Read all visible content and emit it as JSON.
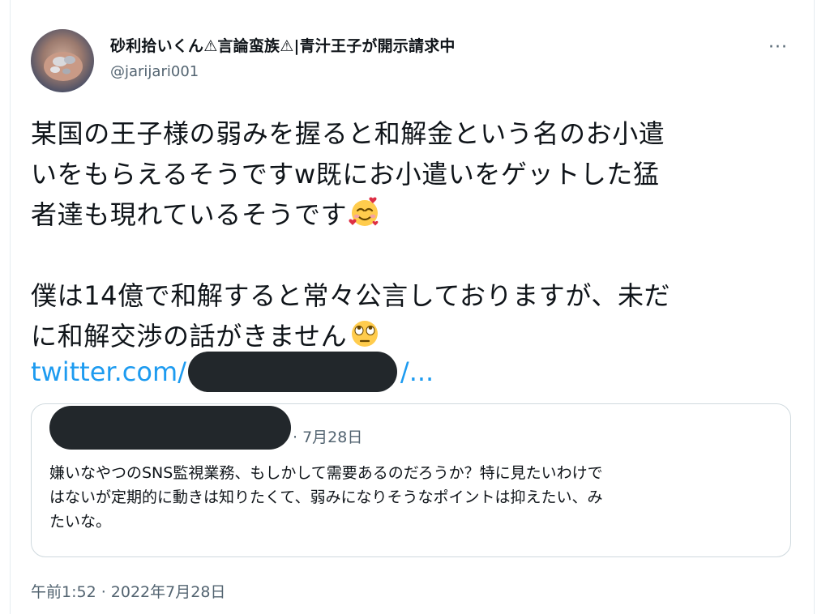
{
  "user": {
    "display_name": "砂利拾いくん⚠言論蛮族⚠|青汁王子が開示請求中",
    "handle": "@jarijari001",
    "more_label": "···"
  },
  "tweet": {
    "lines": [
      "某国の王子様の弱みを握ると和解金という名のお小遣",
      "いをもらえるそうですw既にお小遣いをゲットした猛",
      "者達も現れているそうです"
    ],
    "lines2": [
      "僕は14億で和解すると常々公言しておりますが、未だ",
      "に和解交渉の話がきません"
    ],
    "emoji1": "smiling-face-with-hearts",
    "emoji2": "face-with-rolling-eyes",
    "link_prefix": "twitter.com/",
    "link_suffix": "/..."
  },
  "quote": {
    "date": "· 7月28日",
    "lines": [
      "嫌いなやつのSNS監視業務、もしかして需要あるのだろうか？特に見たいわけで",
      "はないが定期的に動きは知りたくて、弱みになりそうなポイントは抑えたい、み",
      "たいな。"
    ]
  },
  "timestamp": "午前1:52 · 2022年7月28日",
  "colors": {
    "link": "#1d9bf0",
    "secondary_text": "#536471",
    "redaction": "#22272b"
  }
}
